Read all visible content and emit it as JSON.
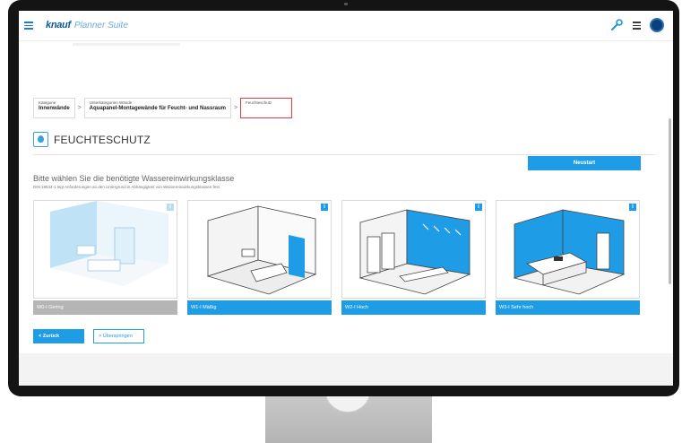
{
  "header": {
    "brand_logo": "knauf",
    "brand_suite": "Planner Suite"
  },
  "breadcrumb": [
    {
      "label": "Kategorie",
      "value": "Innenwände"
    },
    {
      "label": "Unterkategorien Wände",
      "value": "Aquapanel-Montagewände für Feucht- und Nassraum"
    },
    {
      "label": "Feuchteschutz",
      "value": ""
    }
  ],
  "section": {
    "title": "FEUCHTESCHUTZ",
    "restart_label": "Neustart"
  },
  "question": "Bitte wählen Sie die benötigte Wassereinwirkungsklasse",
  "hint": "DIN 18534-1 legt Anforderungen an den Untergrund in Abhängigkeit von Wassereinwirkungsklassen fest",
  "cards": [
    {
      "label": "W0-I Gering",
      "info": "i",
      "state": "disabled"
    },
    {
      "label": "W1-I Mäßig",
      "info": "i",
      "state": "enabled"
    },
    {
      "label": "W2-I Hoch",
      "info": "i",
      "state": "enabled"
    },
    {
      "label": "W3-I Sehr hoch",
      "info": "i",
      "state": "enabled"
    }
  ],
  "buttons": {
    "back": "<  Zurück",
    "skip": "> Überspringen"
  },
  "colors": {
    "accent": "#1f9ce6",
    "brand": "#0b5aa3",
    "active_border": "#e63b3b",
    "disabled": "#b5b5b5"
  }
}
